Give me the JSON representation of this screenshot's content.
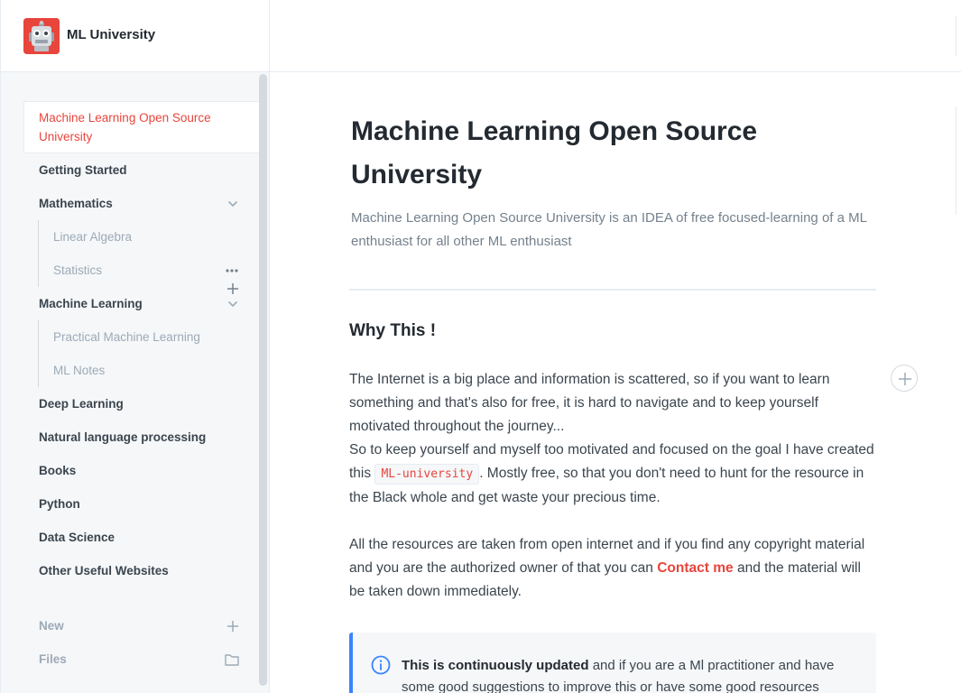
{
  "header": {
    "brand": "ML University",
    "logo_icon": "robot-icon"
  },
  "sidebar": {
    "items": [
      {
        "label": "Machine Learning Open Source University",
        "active": true
      },
      {
        "label": "Getting Started"
      },
      {
        "label": "Mathematics",
        "expandable": true
      },
      {
        "label": "Linear Algebra",
        "sub": true
      },
      {
        "label": "Statistics",
        "sub": true
      },
      {
        "label": "Machine Learning",
        "expandable": true
      },
      {
        "label": "Practical Machine Learning",
        "sub": true
      },
      {
        "label": "ML Notes",
        "sub": true
      },
      {
        "label": "Deep Learning"
      },
      {
        "label": "Natural language processing"
      },
      {
        "label": "Books"
      },
      {
        "label": "Python"
      },
      {
        "label": "Data Science"
      },
      {
        "label": "Other Useful Websites"
      }
    ],
    "bottom": {
      "new_label": "New",
      "files_label": "Files"
    }
  },
  "main": {
    "title": "Machine Learning Open Source University",
    "description": "Machine Learning Open Source University is an IDEA of free focused-learning of a ML enthusiast for all other ML enthusiast",
    "heading": "Why This !",
    "para1": "The Internet is a big place and information is scattered, so if you want to learn something and that's also for free, it is hard to navigate and to keep yourself motivated throughout the journey...",
    "para2_a": "So to keep yourself and myself too motivated and focused on the goal I have created this",
    "para2_code": "ML-university",
    "para2_b": ". Mostly free, so that you don't need to hunt for the resource in the Black whole and get waste your precious time.",
    "para3_a": "All the resources are taken from open internet and if you find any copyright material and you are the authorized owner of that you can",
    "para3_link": "Contact me",
    "para3_b": "and the material will be taken down immediately.",
    "hint_bold": "This is continuously updated",
    "hint_rest": "and if you are a Ml practitioner and have some good suggestions to improve this or have some good resources"
  },
  "colors": {
    "accent": "#e8453c",
    "info": "#3884ff"
  }
}
